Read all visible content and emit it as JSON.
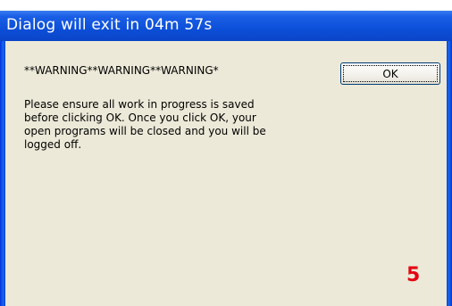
{
  "window": {
    "title": "Dialog will exit in 04m 57s"
  },
  "dialog": {
    "warning": "**WARNING**WARNING**WARNING*",
    "message": "Please ensure all work in progress is saved\nbefore clicking OK. Once you click OK, your\nopen programs will be closed and you will be\nlogged off.",
    "ok_label": "OK"
  },
  "annotation": {
    "number": "5",
    "color": "#e30613"
  },
  "theme": {
    "titlebar_color": "#0c4fd8",
    "client_color": "#ece9d8"
  }
}
